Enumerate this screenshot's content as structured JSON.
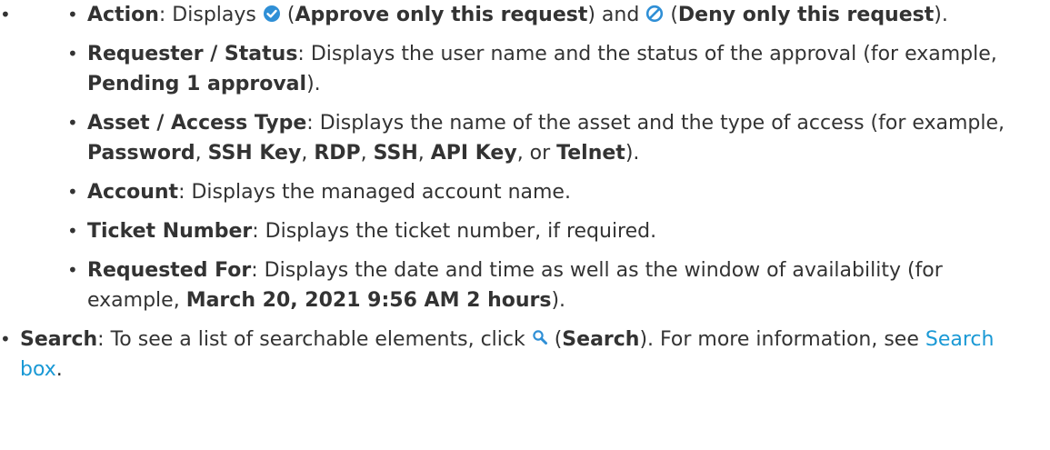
{
  "action": {
    "label": "Action",
    "text_pre": ": Displays ",
    "text_mid1": " (",
    "approve_label": "Approve only this request",
    "text_mid2": ") and ",
    "text_mid3": " (",
    "deny_label": "Deny only this request",
    "text_end": ").",
    "approve_color": "#2f8fd6",
    "deny_color": "#2f8fd6"
  },
  "requester": {
    "label": "Requester / Status",
    "text": ": Displays the user name and the status of the approval (for example, ",
    "example": "Pending 1 approval",
    "text_end": ")."
  },
  "asset": {
    "label": "Asset / Access Type",
    "text": ": Displays the name of the asset and the type of access (for example, ",
    "ex1": "Password",
    "sep1": ", ",
    "ex2": "SSH Key",
    "sep2": ", ",
    "ex3": "RDP",
    "sep3": ", ",
    "ex4": "SSH",
    "sep4": ", ",
    "ex5": "API Key",
    "sep5": ", or ",
    "ex6": "Telnet",
    "text_end": ")."
  },
  "account": {
    "label": "Account",
    "text": ": Displays the managed account name."
  },
  "ticket": {
    "label": "Ticket Number",
    "text": ": Displays the ticket number, if required."
  },
  "requested_for": {
    "label": "Requested For",
    "text": ": Displays the date and time as well as the window of availability (for example, ",
    "example": "March 20, 2021 9:56 AM 2 hours",
    "text_end": ")."
  },
  "search": {
    "label": "Search",
    "text": ": To see a list of searchable elements, click ",
    "text_mid": " (",
    "search_label": "Search",
    "text_mid2": "). For more information, see ",
    "link_text": "Search box",
    "text_end": ".",
    "icon_color": "#2f8fd6"
  }
}
